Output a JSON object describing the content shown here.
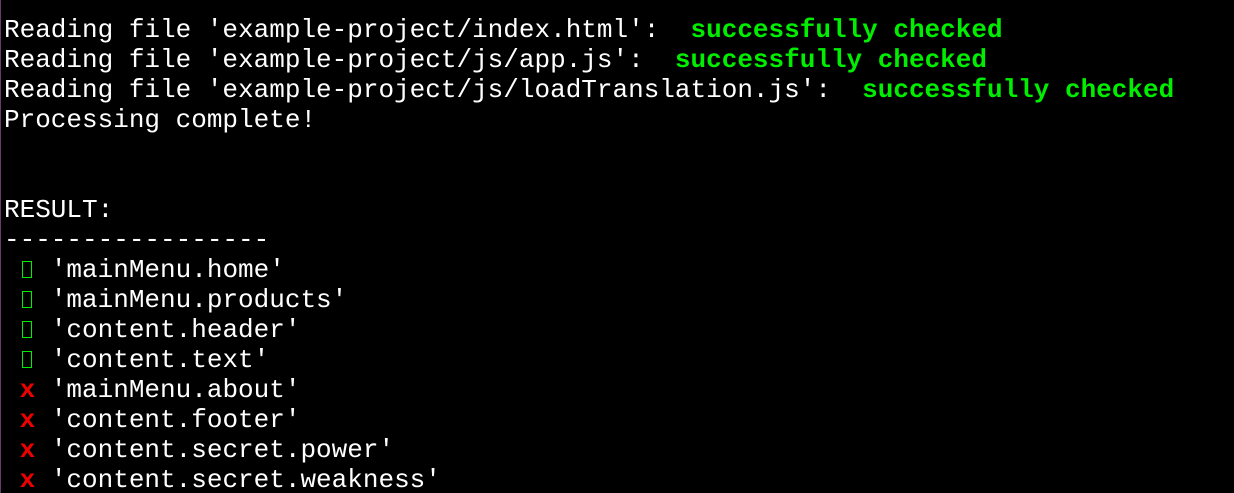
{
  "colors": {
    "background": "#000000",
    "text": "#ffffff",
    "success": "#00ee00",
    "failure": "#ee0000"
  },
  "log": [
    {
      "prefix": "Reading file 'example-project/index.html':  ",
      "status": "successfully checked"
    },
    {
      "prefix": "Reading file 'example-project/js/app.js':  ",
      "status": "successfully checked"
    },
    {
      "prefix": "Reading file 'example-project/js/loadTranslation.js':  ",
      "status": "successfully checked"
    }
  ],
  "processing_text": "Processing complete!",
  "result_label": "RESULT:",
  "separator": "-----------------",
  "results": [
    {
      "mark_icon": "check-icon",
      "mark": "",
      "key": "'mainMenu.home'"
    },
    {
      "mark_icon": "check-icon",
      "mark": "",
      "key": "'mainMenu.products'"
    },
    {
      "mark_icon": "check-icon",
      "mark": "",
      "key": "'content.header'"
    },
    {
      "mark_icon": "check-icon",
      "mark": "",
      "key": "'content.text'"
    },
    {
      "mark_icon": "cross-icon",
      "mark": "x",
      "key": "'mainMenu.about'"
    },
    {
      "mark_icon": "cross-icon",
      "mark": "x",
      "key": "'content.footer'"
    },
    {
      "mark_icon": "cross-icon",
      "mark": "x",
      "key": "'content.secret.power'"
    },
    {
      "mark_icon": "cross-icon",
      "mark": "x",
      "key": "'content.secret.weakness'"
    }
  ]
}
